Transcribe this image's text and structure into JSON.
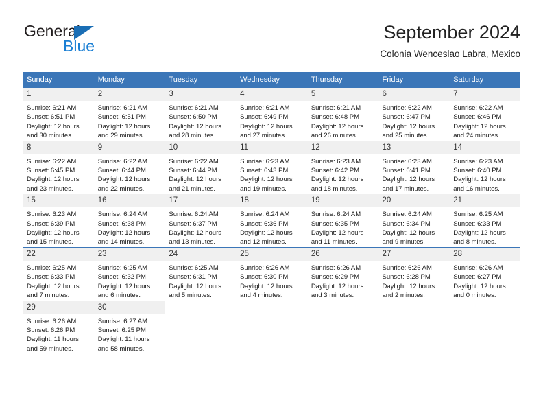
{
  "brand": {
    "name_top": "General",
    "name_bottom": "Blue",
    "triangle_color": "#1a6eb5",
    "blue_color": "#1a7fd4"
  },
  "header": {
    "title": "September 2024",
    "subtitle": "Colonia Wenceslao Labra, Mexico"
  },
  "theme": {
    "header_bg": "#3b76b8",
    "daynum_bg": "#f0f0f0",
    "row_border": "#3b76b8",
    "text": "#1a1a1a"
  },
  "weekdays": [
    "Sunday",
    "Monday",
    "Tuesday",
    "Wednesday",
    "Thursday",
    "Friday",
    "Saturday"
  ],
  "weeks": [
    [
      {
        "day": "1",
        "sunrise": "Sunrise: 6:21 AM",
        "sunset": "Sunset: 6:51 PM",
        "daylight1": "Daylight: 12 hours",
        "daylight2": "and 30 minutes."
      },
      {
        "day": "2",
        "sunrise": "Sunrise: 6:21 AM",
        "sunset": "Sunset: 6:51 PM",
        "daylight1": "Daylight: 12 hours",
        "daylight2": "and 29 minutes."
      },
      {
        "day": "3",
        "sunrise": "Sunrise: 6:21 AM",
        "sunset": "Sunset: 6:50 PM",
        "daylight1": "Daylight: 12 hours",
        "daylight2": "and 28 minutes."
      },
      {
        "day": "4",
        "sunrise": "Sunrise: 6:21 AM",
        "sunset": "Sunset: 6:49 PM",
        "daylight1": "Daylight: 12 hours",
        "daylight2": "and 27 minutes."
      },
      {
        "day": "5",
        "sunrise": "Sunrise: 6:21 AM",
        "sunset": "Sunset: 6:48 PM",
        "daylight1": "Daylight: 12 hours",
        "daylight2": "and 26 minutes."
      },
      {
        "day": "6",
        "sunrise": "Sunrise: 6:22 AM",
        "sunset": "Sunset: 6:47 PM",
        "daylight1": "Daylight: 12 hours",
        "daylight2": "and 25 minutes."
      },
      {
        "day": "7",
        "sunrise": "Sunrise: 6:22 AM",
        "sunset": "Sunset: 6:46 PM",
        "daylight1": "Daylight: 12 hours",
        "daylight2": "and 24 minutes."
      }
    ],
    [
      {
        "day": "8",
        "sunrise": "Sunrise: 6:22 AM",
        "sunset": "Sunset: 6:45 PM",
        "daylight1": "Daylight: 12 hours",
        "daylight2": "and 23 minutes."
      },
      {
        "day": "9",
        "sunrise": "Sunrise: 6:22 AM",
        "sunset": "Sunset: 6:44 PM",
        "daylight1": "Daylight: 12 hours",
        "daylight2": "and 22 minutes."
      },
      {
        "day": "10",
        "sunrise": "Sunrise: 6:22 AM",
        "sunset": "Sunset: 6:44 PM",
        "daylight1": "Daylight: 12 hours",
        "daylight2": "and 21 minutes."
      },
      {
        "day": "11",
        "sunrise": "Sunrise: 6:23 AM",
        "sunset": "Sunset: 6:43 PM",
        "daylight1": "Daylight: 12 hours",
        "daylight2": "and 19 minutes."
      },
      {
        "day": "12",
        "sunrise": "Sunrise: 6:23 AM",
        "sunset": "Sunset: 6:42 PM",
        "daylight1": "Daylight: 12 hours",
        "daylight2": "and 18 minutes."
      },
      {
        "day": "13",
        "sunrise": "Sunrise: 6:23 AM",
        "sunset": "Sunset: 6:41 PM",
        "daylight1": "Daylight: 12 hours",
        "daylight2": "and 17 minutes."
      },
      {
        "day": "14",
        "sunrise": "Sunrise: 6:23 AM",
        "sunset": "Sunset: 6:40 PM",
        "daylight1": "Daylight: 12 hours",
        "daylight2": "and 16 minutes."
      }
    ],
    [
      {
        "day": "15",
        "sunrise": "Sunrise: 6:23 AM",
        "sunset": "Sunset: 6:39 PM",
        "daylight1": "Daylight: 12 hours",
        "daylight2": "and 15 minutes."
      },
      {
        "day": "16",
        "sunrise": "Sunrise: 6:24 AM",
        "sunset": "Sunset: 6:38 PM",
        "daylight1": "Daylight: 12 hours",
        "daylight2": "and 14 minutes."
      },
      {
        "day": "17",
        "sunrise": "Sunrise: 6:24 AM",
        "sunset": "Sunset: 6:37 PM",
        "daylight1": "Daylight: 12 hours",
        "daylight2": "and 13 minutes."
      },
      {
        "day": "18",
        "sunrise": "Sunrise: 6:24 AM",
        "sunset": "Sunset: 6:36 PM",
        "daylight1": "Daylight: 12 hours",
        "daylight2": "and 12 minutes."
      },
      {
        "day": "19",
        "sunrise": "Sunrise: 6:24 AM",
        "sunset": "Sunset: 6:35 PM",
        "daylight1": "Daylight: 12 hours",
        "daylight2": "and 11 minutes."
      },
      {
        "day": "20",
        "sunrise": "Sunrise: 6:24 AM",
        "sunset": "Sunset: 6:34 PM",
        "daylight1": "Daylight: 12 hours",
        "daylight2": "and 9 minutes."
      },
      {
        "day": "21",
        "sunrise": "Sunrise: 6:25 AM",
        "sunset": "Sunset: 6:33 PM",
        "daylight1": "Daylight: 12 hours",
        "daylight2": "and 8 minutes."
      }
    ],
    [
      {
        "day": "22",
        "sunrise": "Sunrise: 6:25 AM",
        "sunset": "Sunset: 6:33 PM",
        "daylight1": "Daylight: 12 hours",
        "daylight2": "and 7 minutes."
      },
      {
        "day": "23",
        "sunrise": "Sunrise: 6:25 AM",
        "sunset": "Sunset: 6:32 PM",
        "daylight1": "Daylight: 12 hours",
        "daylight2": "and 6 minutes."
      },
      {
        "day": "24",
        "sunrise": "Sunrise: 6:25 AM",
        "sunset": "Sunset: 6:31 PM",
        "daylight1": "Daylight: 12 hours",
        "daylight2": "and 5 minutes."
      },
      {
        "day": "25",
        "sunrise": "Sunrise: 6:26 AM",
        "sunset": "Sunset: 6:30 PM",
        "daylight1": "Daylight: 12 hours",
        "daylight2": "and 4 minutes."
      },
      {
        "day": "26",
        "sunrise": "Sunrise: 6:26 AM",
        "sunset": "Sunset: 6:29 PM",
        "daylight1": "Daylight: 12 hours",
        "daylight2": "and 3 minutes."
      },
      {
        "day": "27",
        "sunrise": "Sunrise: 6:26 AM",
        "sunset": "Sunset: 6:28 PM",
        "daylight1": "Daylight: 12 hours",
        "daylight2": "and 2 minutes."
      },
      {
        "day": "28",
        "sunrise": "Sunrise: 6:26 AM",
        "sunset": "Sunset: 6:27 PM",
        "daylight1": "Daylight: 12 hours",
        "daylight2": "and 0 minutes."
      }
    ],
    [
      {
        "day": "29",
        "sunrise": "Sunrise: 6:26 AM",
        "sunset": "Sunset: 6:26 PM",
        "daylight1": "Daylight: 11 hours",
        "daylight2": "and 59 minutes."
      },
      {
        "day": "30",
        "sunrise": "Sunrise: 6:27 AM",
        "sunset": "Sunset: 6:25 PM",
        "daylight1": "Daylight: 11 hours",
        "daylight2": "and 58 minutes."
      },
      {
        "day": "",
        "sunrise": "",
        "sunset": "",
        "daylight1": "",
        "daylight2": ""
      },
      {
        "day": "",
        "sunrise": "",
        "sunset": "",
        "daylight1": "",
        "daylight2": ""
      },
      {
        "day": "",
        "sunrise": "",
        "sunset": "",
        "daylight1": "",
        "daylight2": ""
      },
      {
        "day": "",
        "sunrise": "",
        "sunset": "",
        "daylight1": "",
        "daylight2": ""
      },
      {
        "day": "",
        "sunrise": "",
        "sunset": "",
        "daylight1": "",
        "daylight2": ""
      }
    ]
  ]
}
